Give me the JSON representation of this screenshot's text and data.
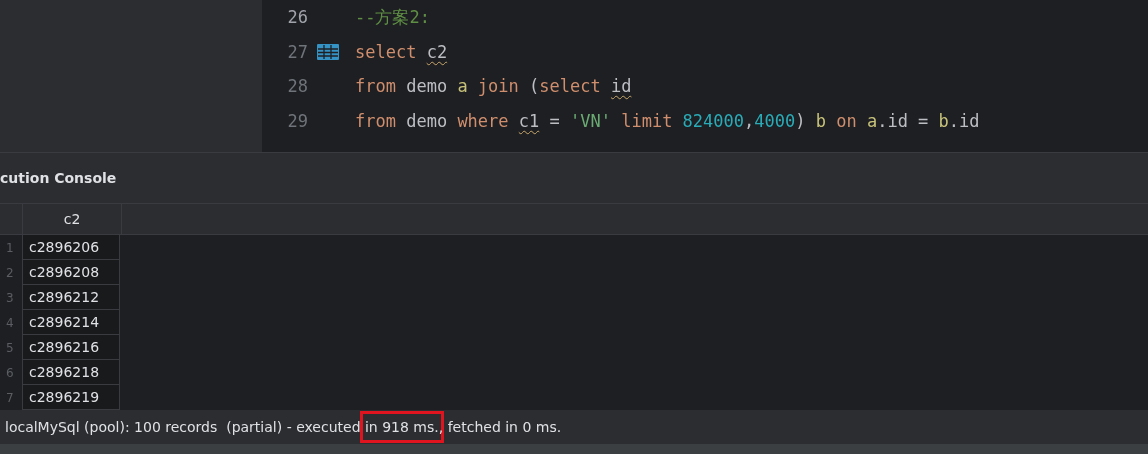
{
  "editor": {
    "lines": [
      {
        "number": "26",
        "table_icon": false,
        "tokens": [
          {
            "kind": "comment",
            "text": "--方案2:",
            "squiggle": false
          }
        ]
      },
      {
        "number": "27",
        "table_icon": true,
        "tokens": [
          {
            "kind": "keyword",
            "text": "select ",
            "squiggle": false
          },
          {
            "kind": "plain",
            "text": "c2",
            "squiggle": true
          }
        ]
      },
      {
        "number": "28",
        "table_icon": false,
        "tokens": [
          {
            "kind": "keyword",
            "text": "from ",
            "squiggle": false
          },
          {
            "kind": "plain",
            "text": "demo ",
            "squiggle": false
          },
          {
            "kind": "alias",
            "text": "a ",
            "squiggle": false
          },
          {
            "kind": "keyword",
            "text": "join ",
            "squiggle": false
          },
          {
            "kind": "plain",
            "text": "(",
            "squiggle": false
          },
          {
            "kind": "keyword",
            "text": "select ",
            "squiggle": false
          },
          {
            "kind": "plain",
            "text": "id",
            "squiggle": true
          }
        ]
      },
      {
        "number": "29",
        "table_icon": false,
        "tokens": [
          {
            "kind": "keyword",
            "text": "from ",
            "squiggle": false
          },
          {
            "kind": "plain",
            "text": "demo ",
            "squiggle": false
          },
          {
            "kind": "keyword",
            "text": "where ",
            "squiggle": false
          },
          {
            "kind": "plain",
            "text": "c1",
            "squiggle": true
          },
          {
            "kind": "plain",
            "text": " = ",
            "squiggle": false
          },
          {
            "kind": "string",
            "text": "'VN' ",
            "squiggle": false
          },
          {
            "kind": "keyword",
            "text": "limit ",
            "squiggle": false
          },
          {
            "kind": "number",
            "text": "824000",
            "squiggle": false
          },
          {
            "kind": "plain",
            "text": ",",
            "squiggle": false
          },
          {
            "kind": "number",
            "text": "4000",
            "squiggle": false
          },
          {
            "kind": "plain",
            "text": ") ",
            "squiggle": false
          },
          {
            "kind": "alias",
            "text": "b ",
            "squiggle": false
          },
          {
            "kind": "keyword",
            "text": "on ",
            "squiggle": false
          },
          {
            "kind": "alias",
            "text": "a",
            "squiggle": false
          },
          {
            "kind": "plain",
            "text": ".id = ",
            "squiggle": false
          },
          {
            "kind": "alias",
            "text": "b",
            "squiggle": false
          },
          {
            "kind": "plain",
            "text": ".id",
            "squiggle": false
          }
        ]
      }
    ]
  },
  "console": {
    "title": "cution Console",
    "table": {
      "columns": [
        "c2"
      ],
      "rows": [
        {
          "number": "1",
          "cells": [
            "c2896206"
          ]
        },
        {
          "number": "2",
          "cells": [
            "c2896208"
          ]
        },
        {
          "number": "3",
          "cells": [
            "c2896212"
          ]
        },
        {
          "number": "4",
          "cells": [
            "c2896214"
          ]
        },
        {
          "number": "5",
          "cells": [
            "c2896216"
          ]
        },
        {
          "number": "6",
          "cells": [
            "c2896218"
          ]
        },
        {
          "number": "7",
          "cells": [
            "c2896219"
          ]
        }
      ]
    }
  },
  "status_bar": {
    "segments": [
      {
        "text": "localMySql (pool): 100 records  (partial) - executed ",
        "highlighted": false
      },
      {
        "text": "in 918 ms.",
        "highlighted": true
      },
      {
        "text": ", fetched in 0 ms.",
        "highlighted": false
      }
    ]
  }
}
